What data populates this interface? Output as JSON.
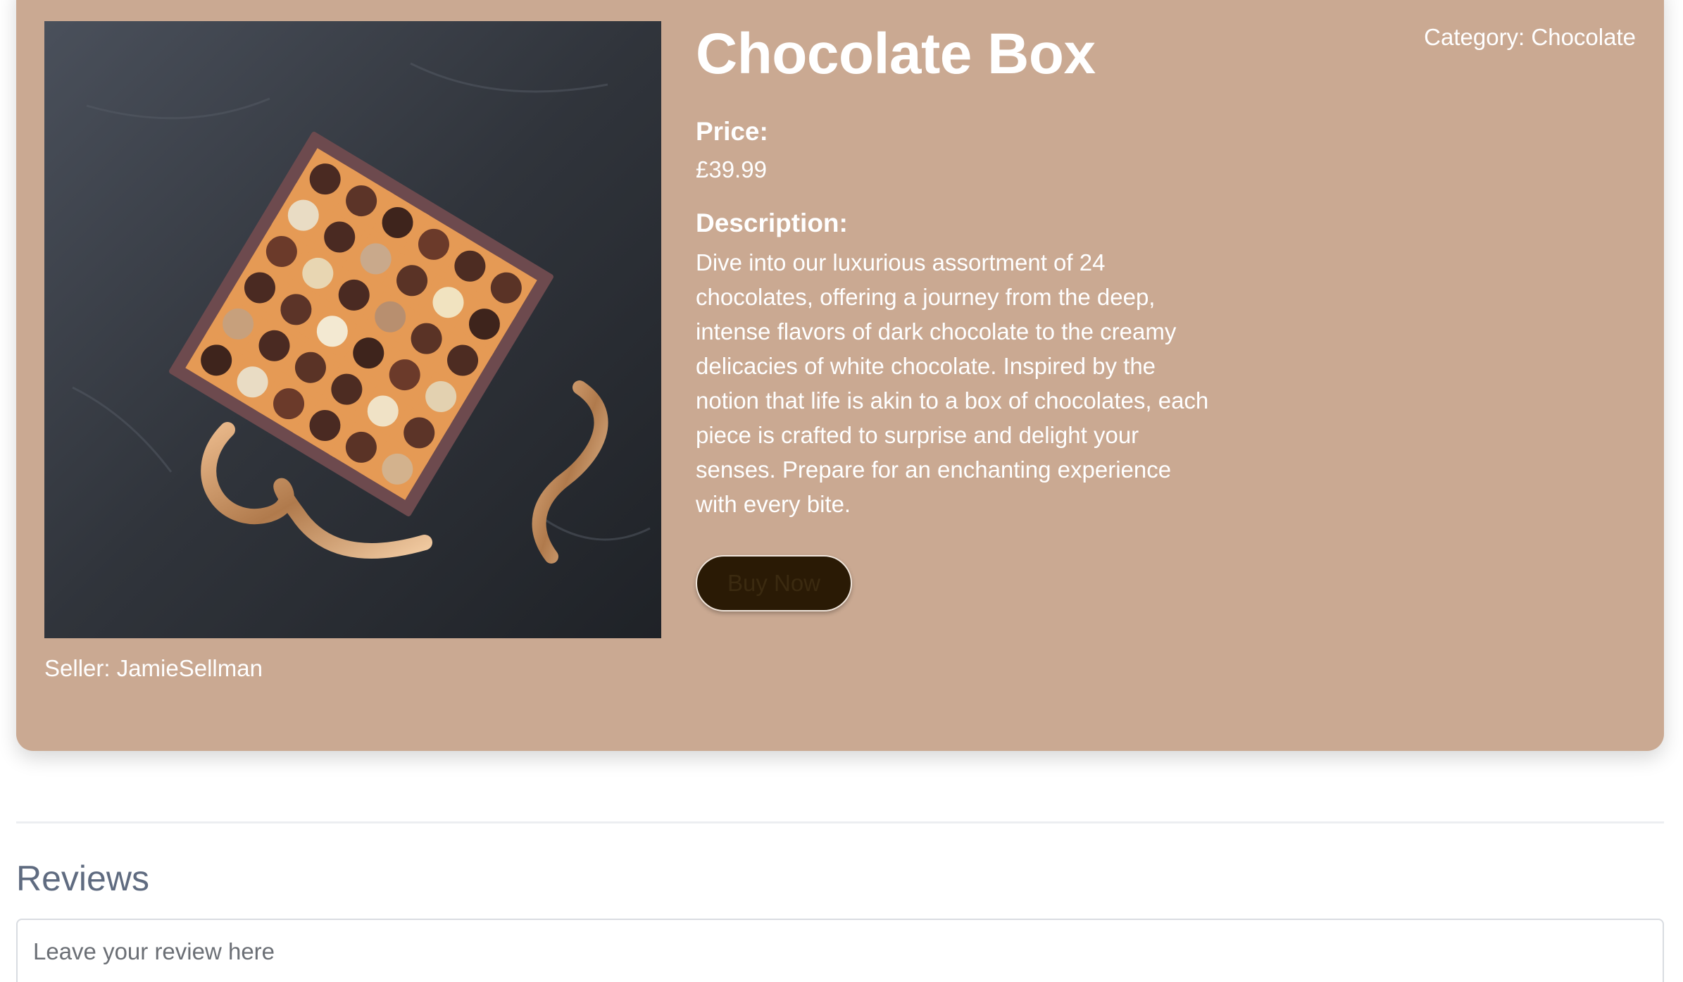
{
  "product": {
    "category": "Category: Chocolate",
    "title": "Chocolate Box",
    "price_label": "Price:",
    "price_value": "£39.99",
    "description_label": "Description:",
    "description": "Dive into our luxurious assortment of 24 chocolates, offering a journey from the deep, intense flavors of dark chocolate to the creamy delicacies of white chocolate. Inspired by the notion that life is akin to a box of chocolates, each piece is crafted to surprise and delight your senses. Prepare for an enchanting experience with every bite.",
    "buy_label": "Buy Now",
    "seller": "Seller: JamieSellman"
  },
  "reviews": {
    "heading": "Reviews",
    "placeholder": "Leave your review here"
  },
  "colors": {
    "card_background": "#caa992",
    "button_background": "#2a1a05",
    "heading_gray": "#5f6b80"
  }
}
